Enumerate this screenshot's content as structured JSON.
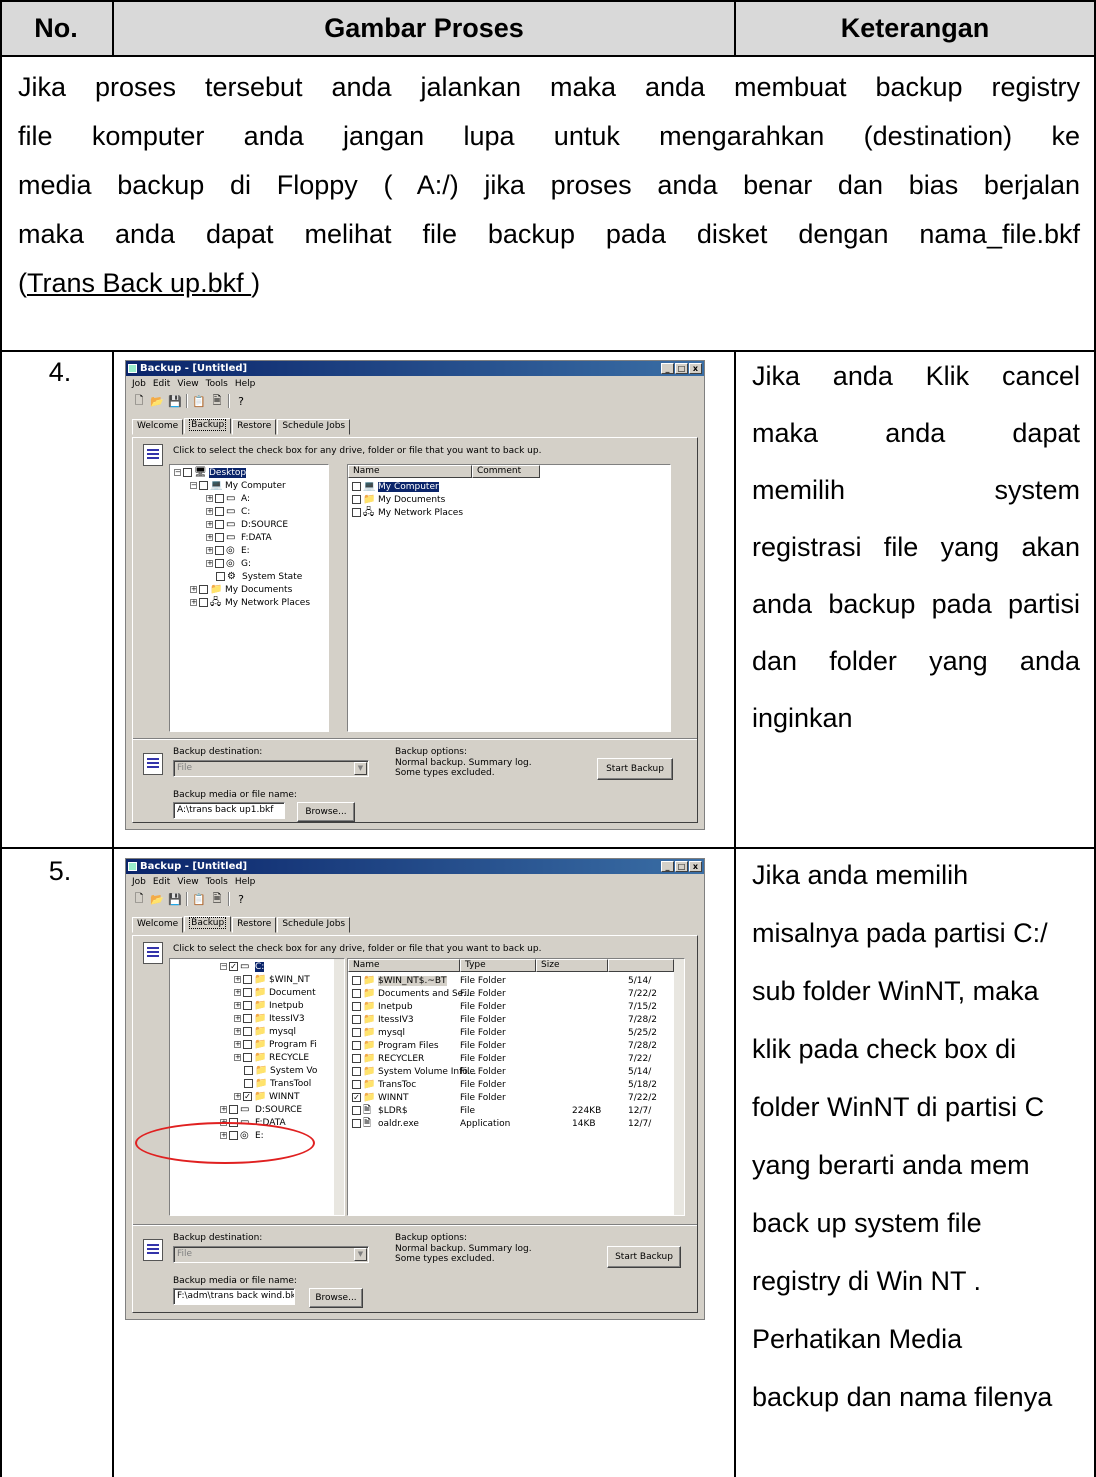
{
  "table": {
    "headers": [
      "No.",
      "Gambar Proses",
      "Keterangan"
    ],
    "intro_lines": [
      "Jika proses tersebut anda jalankan maka anda membuat backup registry",
      "file komputer anda jangan lupa untuk mengarahkan (destination) ke",
      "media backup di Floppy ( A:/) jika proses anda benar dan bias berjalan",
      "maka anda dapat melihat file backup pada disket dengan nama_file.bkf"
    ],
    "intro_link": "Trans Back up.bkf ",
    "intro_open": "(",
    "intro_close": ")",
    "rows": [
      {
        "no": "4.",
        "desc_lines": [
          "Jika anda Klik cancel",
          "maka anda dapat",
          "memilih system",
          "registrasi file yang akan",
          "anda backup pada partisi",
          "dan folder yang anda",
          "inginkan"
        ]
      },
      {
        "no": "5.",
        "desc_lines": [
          "Jika anda memilih",
          "misalnya pada partisi C:/",
          "sub folder  WinNT, maka",
          "klik pada check box di",
          "folder WinNT di partisi C",
          "yang berarti anda mem",
          "back up system file",
          "registry di Win NT .",
          "Perhatikan  Media",
          "backup dan nama filenya"
        ]
      }
    ]
  },
  "shot1": {
    "title": "Backup - [Untitled]",
    "menu": [
      "Job",
      "Edit",
      "View",
      "Tools",
      "Help"
    ],
    "tabs": [
      "Welcome",
      "Backup",
      "Restore",
      "Schedule Jobs"
    ],
    "hint": "Click to select the check box for any drive, folder or file that you want to back up.",
    "tree": [
      "Desktop",
      "My Computer",
      "A:",
      "C:",
      "D:SOURCE",
      "F:DATA",
      "E:",
      "G:",
      "System State",
      "My Documents",
      "My Network Places"
    ],
    "list_headers": [
      "Name",
      "Comment"
    ],
    "list": [
      "My Computer",
      "My Documents",
      "My Network Places"
    ],
    "dest_label": "Backup destination:",
    "dest_value": "File",
    "options_label": "Backup options:",
    "options_line1": "Normal backup. Summary log.",
    "options_line2": "Some types excluded.",
    "media_label": "Backup media or file name:",
    "media_value": "A:\\trans back up1.bkf",
    "browse": "Browse...",
    "start": "Start Backup"
  },
  "shot2": {
    "title": "Backup - [Untitled]",
    "menu": [
      "Job",
      "Edit",
      "View",
      "Tools",
      "Help"
    ],
    "tabs": [
      "Welcome",
      "Backup",
      "Restore",
      "Schedule Jobs"
    ],
    "hint": "Click to select the check box for any drive, folder or file that you want to back up.",
    "tree": [
      "C:",
      "$WIN_NT",
      "Document",
      "Inetpub",
      "ItessIV3",
      "mysql",
      "Program Fi",
      "RECYCLE",
      "System Vo",
      "TransTool",
      "WINNT",
      "D:SOURCE",
      "F:DATA",
      "E:"
    ],
    "list_headers": [
      "Name",
      "Type",
      "Size",
      ""
    ],
    "list": [
      {
        "name": "$WIN_NT$.~BT",
        "type": "File Folder",
        "size": "",
        "date": "5/14/"
      },
      {
        "name": "Documents and Se...",
        "type": "File Folder",
        "size": "",
        "date": "7/22/2"
      },
      {
        "name": "Inetpub",
        "type": "File Folder",
        "size": "",
        "date": "7/15/2"
      },
      {
        "name": "ItessIV3",
        "type": "File Folder",
        "size": "",
        "date": "7/28/2"
      },
      {
        "name": "mysql",
        "type": "File Folder",
        "size": "",
        "date": "5/25/2"
      },
      {
        "name": "Program Files",
        "type": "File Folder",
        "size": "",
        "date": "7/28/2"
      },
      {
        "name": "RECYCLER",
        "type": "File Folder",
        "size": "",
        "date": "7/22/"
      },
      {
        "name": "System Volume Info...",
        "type": "File Folder",
        "size": "",
        "date": "5/14/"
      },
      {
        "name": "TransToc",
        "type": "File Folder",
        "size": "",
        "date": "5/18/2"
      },
      {
        "name": "WINNT",
        "type": "File Folder",
        "size": "",
        "date": "7/22/2"
      },
      {
        "name": "$LDR$",
        "type": "File",
        "size": "224KB",
        "date": "12/7/"
      },
      {
        "name": "oaldr.exe",
        "type": "Application",
        "size": "14KB",
        "date": "12/7/"
      }
    ],
    "dest_label": "Backup destination:",
    "dest_value": "File",
    "options_label": "Backup options:",
    "options_line1": "Normal backup. Summary log.",
    "options_line2": "Some types excluded.",
    "media_label": "Backup media or file name:",
    "media_value": "F:\\adm\\trans back wind.bkf",
    "browse": "Browse...",
    "start": "Start Backup"
  }
}
